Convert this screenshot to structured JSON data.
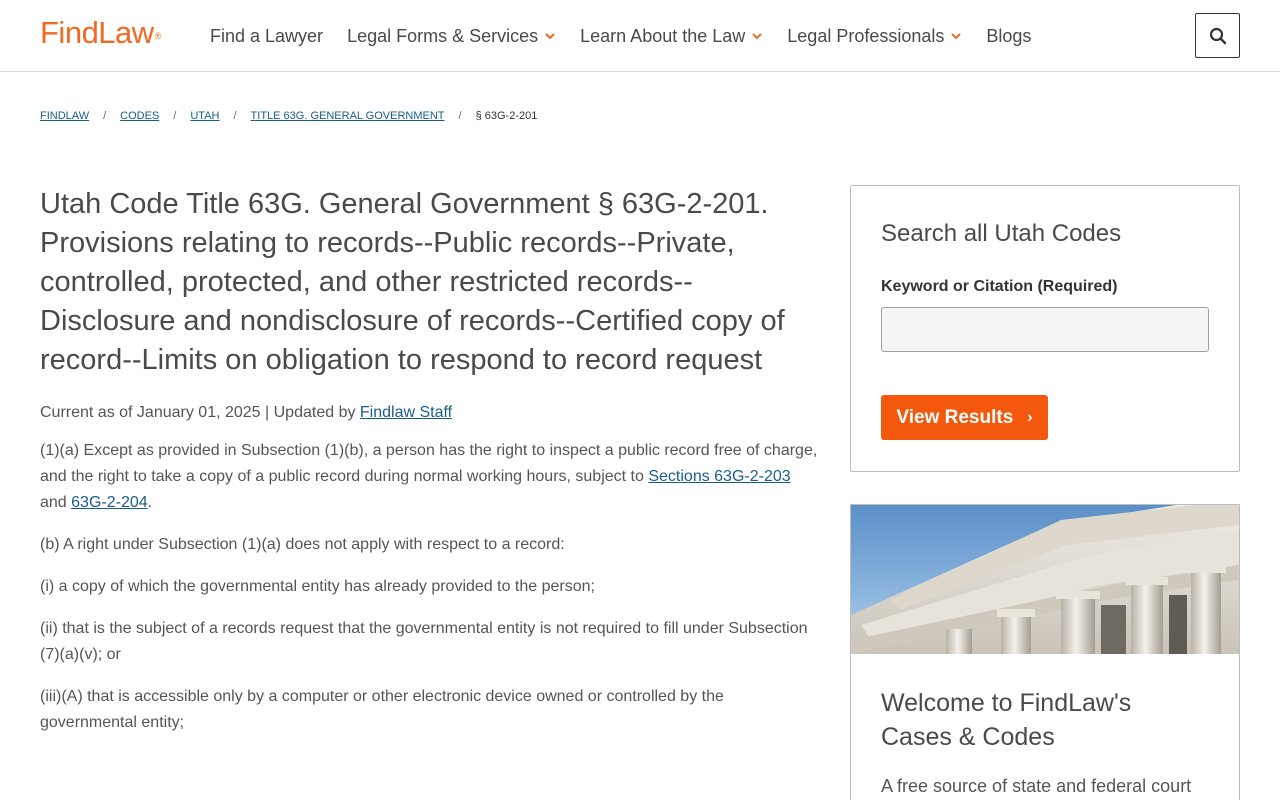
{
  "header": {
    "logo": "FindLaw",
    "logo_reg": "®",
    "nav": [
      {
        "label": "Find a Lawyer",
        "dropdown": false
      },
      {
        "label": "Legal Forms & Services",
        "dropdown": true
      },
      {
        "label": "Learn About the Law",
        "dropdown": true
      },
      {
        "label": "Legal Professionals",
        "dropdown": true
      },
      {
        "label": "Blogs",
        "dropdown": false
      }
    ],
    "search_icon": "search-icon"
  },
  "breadcrumb": {
    "items": [
      "FINDLAW",
      "CODES",
      "UTAH",
      "TITLE 63G. GENERAL GOVERNMENT"
    ],
    "separator": "/",
    "current": "§ 63G-2-201"
  },
  "article": {
    "title": "Utah Code Title 63G. General Government § 63G-2-201. Provisions relating to records--Public records--Private, controlled, protected, and other restricted records--Disclosure and nondisclosure of records--Certified copy of record--Limits on obligation to respond to record request",
    "meta_prefix": "Current as of January 01, 2025 | Updated by ",
    "meta_author": "Findlaw Staff",
    "p1_before": "(1)(a) Except as provided in Subsection (1)(b), a person has the right to inspect a public record free of charge, and the right to take a copy of a public record during normal working hours, subject to ",
    "p1_link1": "Sections 63G-2-203",
    "p1_mid": " and ",
    "p1_link2": "63G-2-204",
    "p1_after": ".",
    "p2": "(b) A right under Subsection (1)(a) does not apply with respect to a record:",
    "p3": "(i) a copy of which the governmental entity has already provided to the person;",
    "p4": "(ii) that is the subject of a records request that the governmental entity is not required to fill under Subsection (7)(a)(v); or",
    "p5": "(iii)(A) that is accessible only by a computer or other electronic device owned or controlled by the governmental entity;"
  },
  "sidebar": {
    "search_title": "Search all Utah Codes",
    "field_label": "Keyword or Citation (Required)",
    "field_value": "",
    "button_label": "View Results",
    "button_arrow": "›",
    "promo_title": "Welcome to FindLaw's Cases & Codes",
    "promo_text": "A free source of state and federal court"
  },
  "colors": {
    "brand": "#f26922",
    "button": "#f4580c",
    "link": "#1a5d8a"
  }
}
